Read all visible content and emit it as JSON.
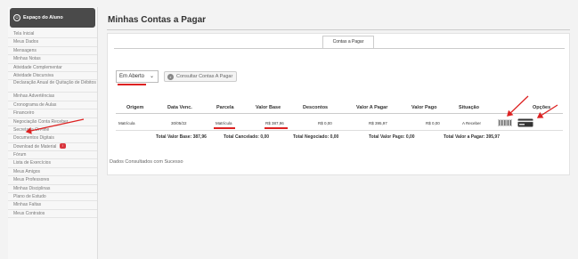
{
  "sidebar": {
    "header": "Espaço do Aluno",
    "items": [
      {
        "label": "Tela Inicial"
      },
      {
        "label": "Meus Dados"
      },
      {
        "label": "Mensagens"
      },
      {
        "label": "Minhas Notas"
      },
      {
        "label": "Atividade Complementar"
      },
      {
        "label": "Atividade Discursiva"
      },
      {
        "label": "Declaração Anual de Quitação de Débitos"
      },
      {
        "label": "Minhas Advertências"
      },
      {
        "label": "Cronograma de Aulas"
      },
      {
        "label": "Financeiro"
      },
      {
        "label": "Negociação Conta Receber"
      },
      {
        "label": "Secretaria On-line"
      },
      {
        "label": "Documentos Digitais"
      },
      {
        "label": "Download de Material"
      },
      {
        "label": "Fórum"
      },
      {
        "label": "Lista de Exercícios"
      },
      {
        "label": "Meus Amigos"
      },
      {
        "label": "Meus Professores"
      },
      {
        "label": "Minhas Disciplinas"
      },
      {
        "label": "Plano de Estudo"
      },
      {
        "label": "Minhas Faltas"
      },
      {
        "label": "Meus Contratos"
      }
    ],
    "download_badge": "!"
  },
  "main": {
    "title": "Minhas Contas a Pagar",
    "tab_label": "Contas a Pagar",
    "filter_value": "Em Aberto",
    "consult_button": "Consultar Contas A Pagar",
    "status_message": "Dados Consultados com Sucesso"
  },
  "table": {
    "headers": [
      "Origem",
      "Data Venc.",
      "Parcela",
      "Valor Base",
      "Descontos",
      "Valor A Pagar",
      "Valor Pago",
      "Situação",
      "Opções"
    ],
    "row": {
      "origem": "Matrícula",
      "data_venc": "30/05/22",
      "parcela": "Matrícula",
      "valor_base": "R$ 387,96",
      "descontos": "R$ 0,00",
      "valor_a_pagar": "R$ 395,97",
      "valor_pago": "R$ 0,00",
      "situacao": "A Receber"
    },
    "totals": {
      "valor_base_label": "Total Valor Base:",
      "valor_base": "387,96",
      "cancelado_label": "Total Cancelado:",
      "cancelado": "0,00",
      "negociado_label": "Total Negociado:",
      "negociado": "0,00",
      "pago_label": "Total Valor Pago:",
      "pago": "0,00",
      "a_pagar_label": "Total Valor a Pagar:",
      "a_pagar": "395,97"
    }
  },
  "icons": {
    "header_icon": "user-circle-icon",
    "consult_icon": "search-icon",
    "option_1": "barcode-icon",
    "option_2": "credit-card-icon"
  },
  "colors": {
    "annotation_red": "#dd2222",
    "badge_red": "#d9363e",
    "sidebar_header": "#4a4a4a"
  }
}
